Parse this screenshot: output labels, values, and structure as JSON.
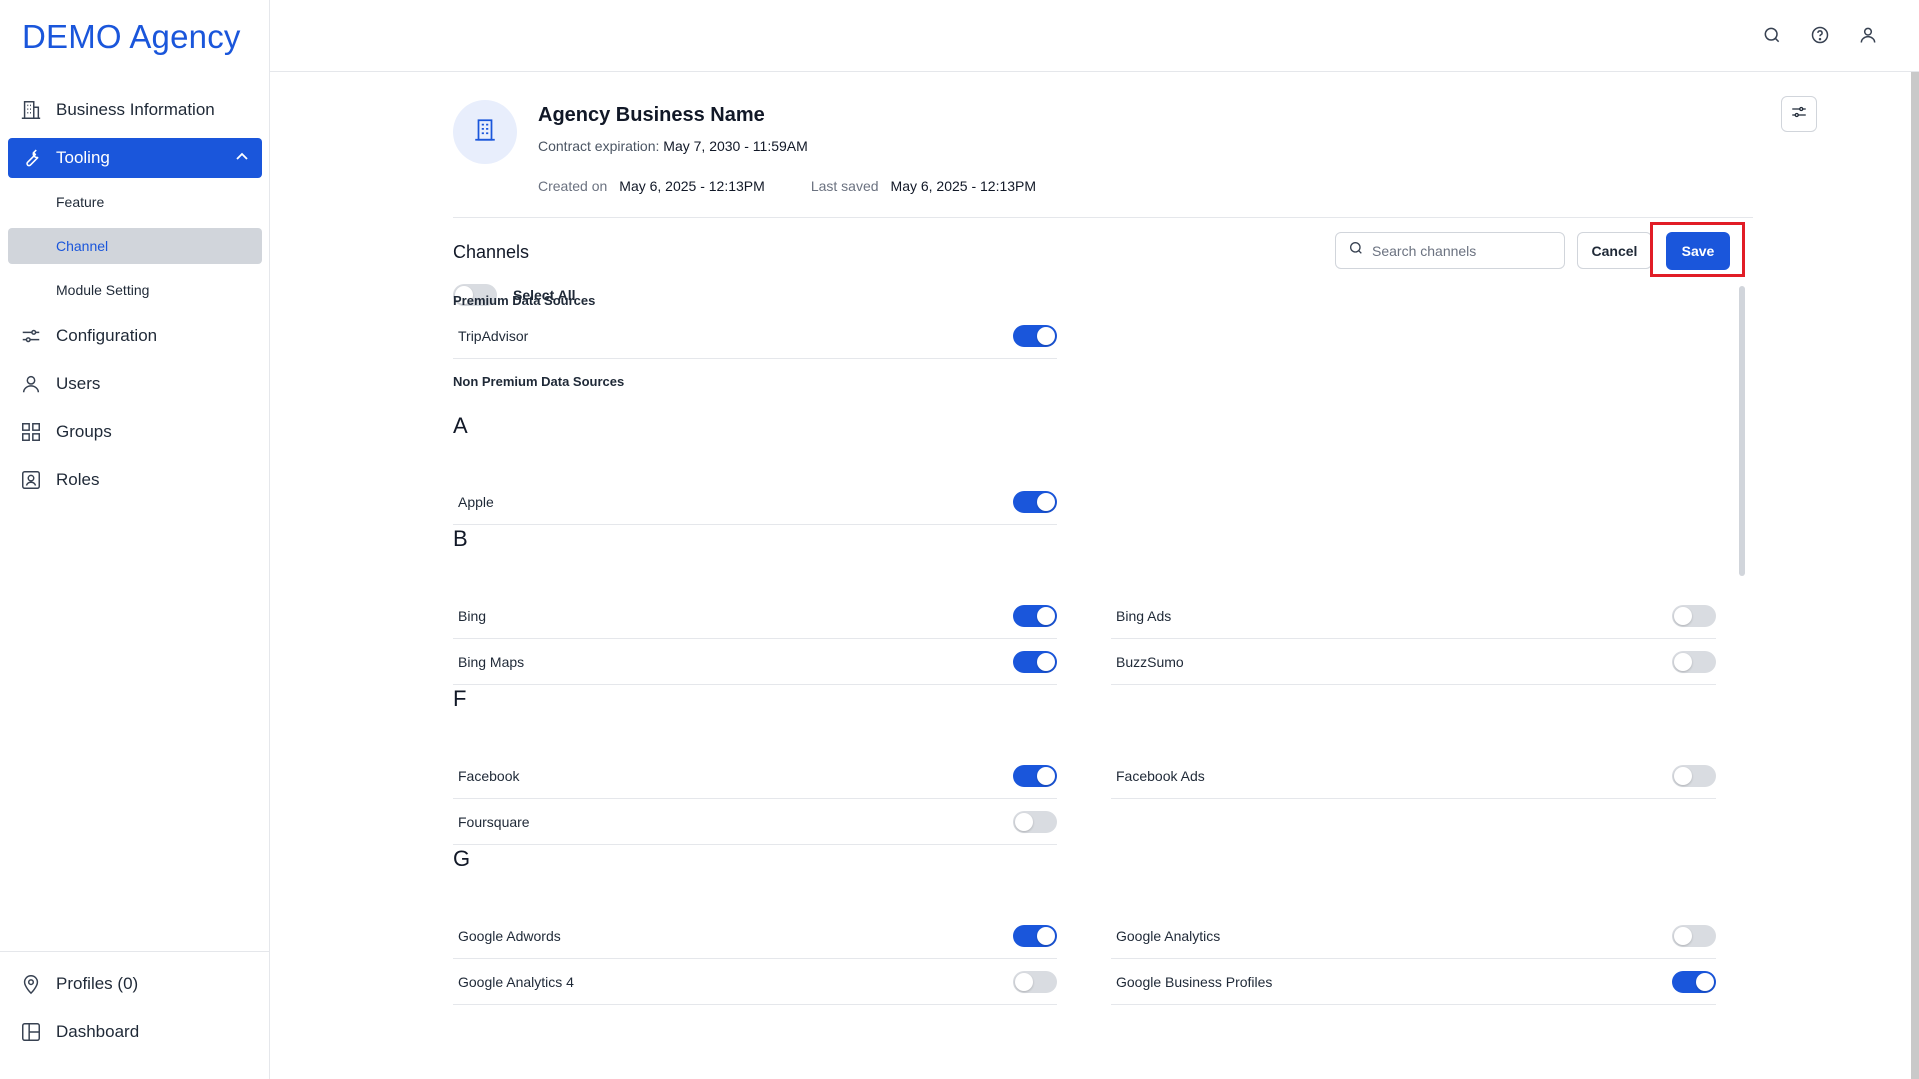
{
  "brand": "DEMO Agency",
  "sidebar": {
    "items": [
      {
        "label": "Business Information",
        "icon": "building-icon"
      },
      {
        "label": "Tooling",
        "icon": "wrench-icon"
      },
      {
        "label": "Configuration",
        "icon": "sliders-icon"
      },
      {
        "label": "Users",
        "icon": "user-icon"
      },
      {
        "label": "Groups",
        "icon": "grid-icon"
      },
      {
        "label": "Roles",
        "icon": "id-card-icon"
      }
    ],
    "sub_items": [
      {
        "label": "Feature"
      },
      {
        "label": "Channel"
      },
      {
        "label": "Module Setting"
      }
    ],
    "bottom": [
      {
        "label": "Profiles (0)",
        "icon": "map-pin-icon"
      },
      {
        "label": "Dashboard",
        "icon": "layout-icon"
      }
    ]
  },
  "topbar": {
    "icons": [
      "search-icon",
      "help-icon",
      "user-icon"
    ]
  },
  "business": {
    "name": "Agency Business Name",
    "contract_label": "Contract expiration:",
    "contract_value": "May 7, 2030 - 11:59AM",
    "created_label": "Created on",
    "created_value": "May 6, 2025 - 12:13PM",
    "saved_label": "Last saved",
    "saved_value": "May 6, 2025 - 12:13PM"
  },
  "channels": {
    "title": "Channels",
    "search_placeholder": "Search channels",
    "cancel_label": "Cancel",
    "save_label": "Save",
    "select_all_label": "Select All",
    "select_all_on": false,
    "premium_title": "Premium Data Sources",
    "non_premium_title": "Non Premium Data Sources",
    "premium": [
      {
        "name": "TripAdvisor",
        "on": true
      }
    ],
    "groups": [
      {
        "letter": "A",
        "items": [
          {
            "name": "Apple",
            "on": true
          }
        ]
      },
      {
        "letter": "B",
        "items": [
          {
            "name": "Bing",
            "on": true
          },
          {
            "name": "Bing Ads",
            "on": false
          },
          {
            "name": "Bing Maps",
            "on": true
          },
          {
            "name": "BuzzSumo",
            "on": false
          }
        ]
      },
      {
        "letter": "F",
        "items": [
          {
            "name": "Facebook",
            "on": true
          },
          {
            "name": "Facebook Ads",
            "on": false
          },
          {
            "name": "Foursquare",
            "on": false
          }
        ]
      },
      {
        "letter": "G",
        "items": [
          {
            "name": "Google Adwords",
            "on": true
          },
          {
            "name": "Google Analytics",
            "on": false
          },
          {
            "name": "Google Analytics 4",
            "on": false
          },
          {
            "name": "Google Business Profiles",
            "on": true
          }
        ]
      }
    ]
  },
  "colors": {
    "accent": "#1a56db",
    "highlight": "#e11d26"
  }
}
